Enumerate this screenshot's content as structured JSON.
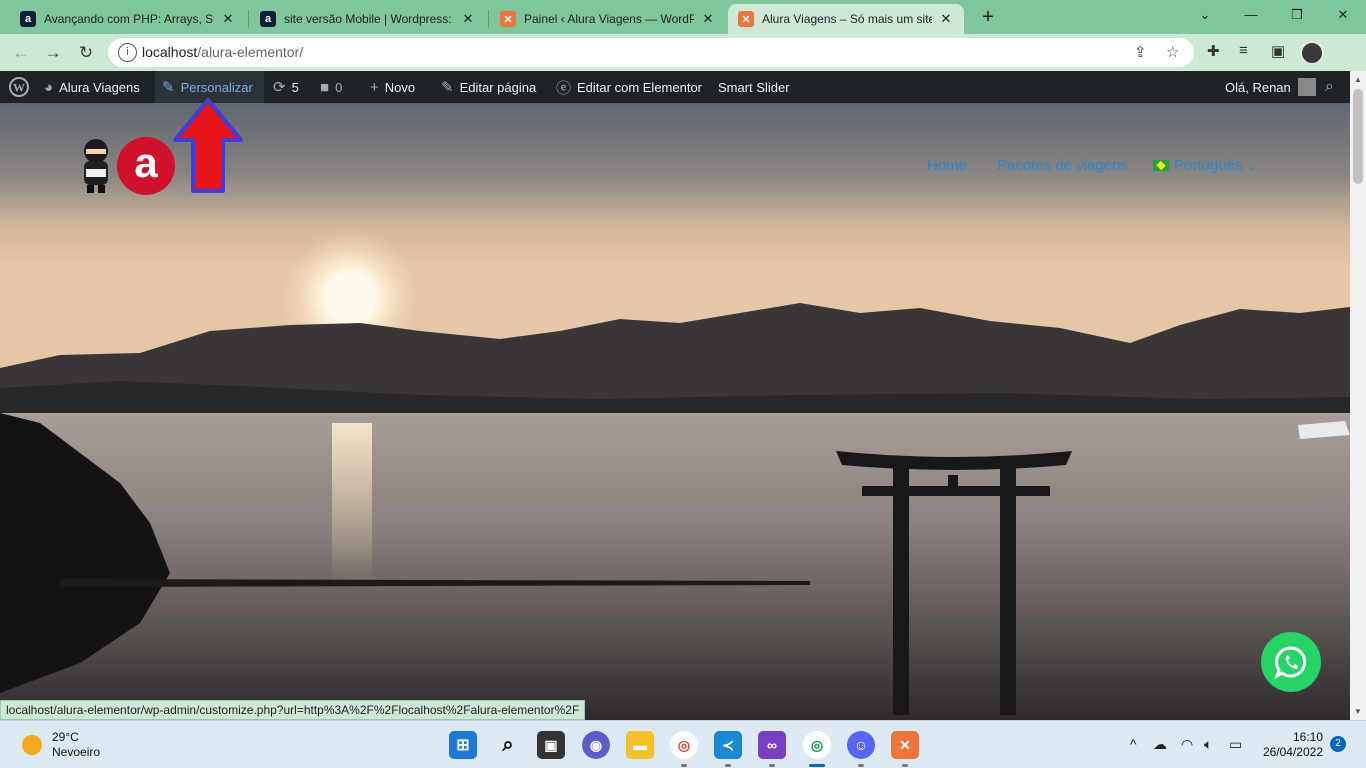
{
  "browser": {
    "tabs": [
      {
        "title": "Avançando com PHP: Arrays, Strings",
        "favicon": "alura-icon"
      },
      {
        "title": "site versão Mobile | Wordpress: ir",
        "favicon": "alura-icon"
      },
      {
        "title": "Painel ‹ Alura Viagens — WordPress",
        "favicon": "xampp-icon"
      },
      {
        "title": "Alura Viagens – Só mais um site W",
        "favicon": "xampp-icon"
      }
    ],
    "active_tab_index": 3,
    "url_host": "localhost",
    "url_path": "/alura-elementor/"
  },
  "admin_bar": {
    "site_name": "Alura Viagens",
    "customize": "Personalizar",
    "updates_count": "5",
    "comments_count": "0",
    "new": "Novo",
    "edit_page": "Editar página",
    "elementor": "Editar com Elementor",
    "smart_slider": "Smart Slider",
    "greeting": "Olá, Renan"
  },
  "site": {
    "nav": [
      "Home",
      "Pacotes de viagens"
    ],
    "language": "Português"
  },
  "status_url": "localhost/alura-elementor/wp-admin/customize.php?url=http%3A%2F%2Flocalhost%2Falura-elementor%2F",
  "taskbar": {
    "temperature": "29°C",
    "weather": "Nevoeiro",
    "time": "16:10",
    "date": "26/04/2022",
    "notifications": "2"
  },
  "colors": {
    "tab_bar": "#7fc79b",
    "toolbar": "#cde9d6",
    "admin_bar": "#1d2327",
    "nav_link": "#2f86c9",
    "arrow": "#e8141b",
    "whatsapp": "#25d366"
  }
}
